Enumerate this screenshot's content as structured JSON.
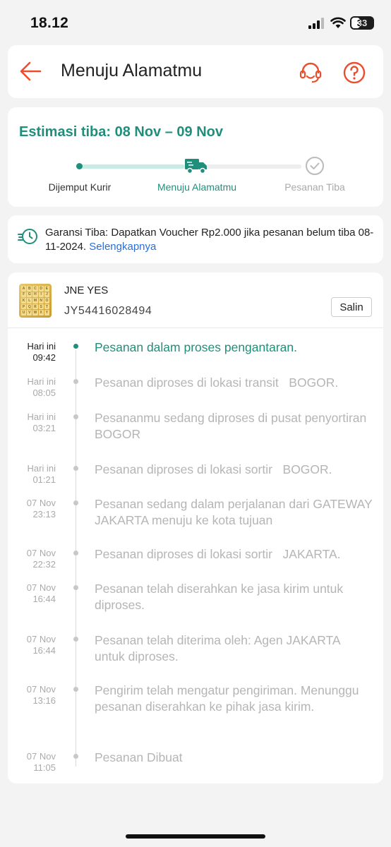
{
  "status_bar": {
    "time": "18.12",
    "battery": "33"
  },
  "header": {
    "title": "Menuju Alamatmu"
  },
  "eta": {
    "title": "Estimasi tiba: 08 Nov – 09 Nov",
    "steps": [
      "Dijemput Kurir",
      "Menuju Alamatmu",
      "Pesanan Tiba"
    ]
  },
  "guarantee": {
    "text": "Garansi Tiba: Dapatkan Voucher Rp2.000 jika pesanan belum tiba 08-11-2024.",
    "link": "Selengkapnya"
  },
  "shipment": {
    "courier": "JNE YES",
    "tracking_number": "JY54416028494",
    "copy_label": "Salin",
    "events": [
      {
        "date": "Hari ini",
        "time": "09:42",
        "text": "Pesanan dalam proses pengantaran."
      },
      {
        "date": "Hari ini",
        "time": "08:05",
        "text": "Pesanan diproses di lokasi transit   BOGOR."
      },
      {
        "date": "Hari ini",
        "time": "03:21",
        "text": "Pesananmu sedang diproses di pusat penyortiran BOGOR"
      },
      {
        "date": "Hari ini",
        "time": "01:21",
        "text": "Pesanan diproses di lokasi sortir   BOGOR."
      },
      {
        "date": "07 Nov",
        "time": "23:13",
        "text": "Pesanan sedang dalam perjalanan dari GATEWAY JAKARTA menuju ke kota tujuan"
      },
      {
        "date": "07 Nov",
        "time": "22:32",
        "text": "Pesanan diproses di lokasi sortir   JAKARTA."
      },
      {
        "date": "07 Nov",
        "time": "16:44",
        "text": "Pesanan telah diserahkan ke jasa kirim untuk diproses."
      },
      {
        "date": "07 Nov",
        "time": "16:44",
        "text": "Pesanan telah diterima oleh: Agen JAKARTA untuk diproses."
      },
      {
        "date": "07 Nov",
        "time": "13:16",
        "text": "Pengirim telah mengatur pengiriman. Menunggu pesanan diserahkan ke pihak jasa kirim."
      },
      {
        "date": "07 Nov",
        "time": "11:05",
        "text": "Pesanan Dibuat"
      }
    ]
  },
  "colors": {
    "accent": "#1f8f7c",
    "brand": "#ee4d2d",
    "link": "#2a6fd6"
  }
}
